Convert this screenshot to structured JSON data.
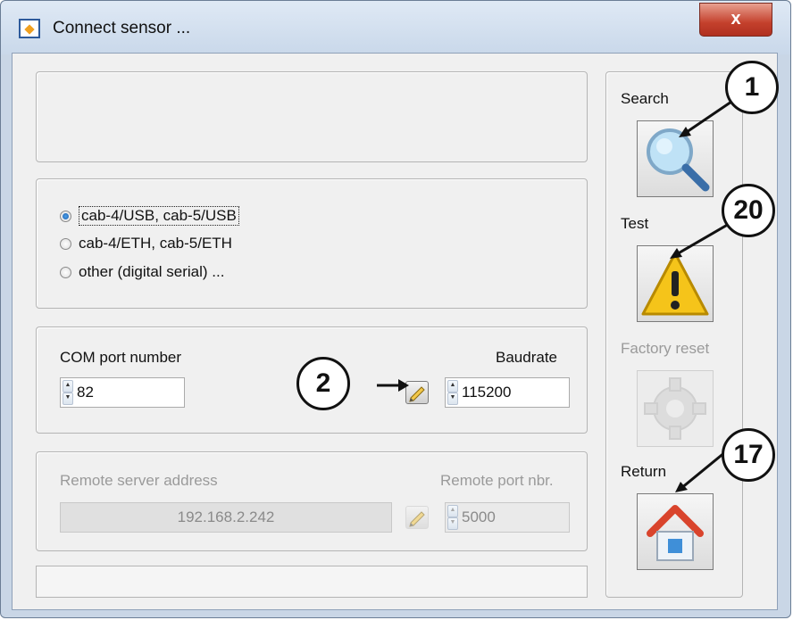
{
  "window": {
    "title": "Connect sensor ...",
    "close_label": "x"
  },
  "connection_type": {
    "options": [
      {
        "label": "cab-4/USB, cab-5/USB",
        "selected": true
      },
      {
        "label": "cab-4/ETH, cab-5/ETH",
        "selected": false
      },
      {
        "label": "other (digital serial) ...",
        "selected": false
      }
    ]
  },
  "serial": {
    "com_label": "COM port number",
    "com_value": "82",
    "baud_label": "Baudrate",
    "baud_value": "115200"
  },
  "network": {
    "address_label": "Remote server address",
    "address_value": "192.168.2.242",
    "port_label": "Remote port nbr.",
    "port_value": "5000"
  },
  "sidebar": {
    "search_label": "Search",
    "test_label": "Test",
    "factory_reset_label": "Factory reset",
    "return_label": "Return"
  },
  "callouts": {
    "search": "1",
    "test": "20",
    "edit": "2",
    "return": "17"
  },
  "icons": {
    "search": "magnifier-icon",
    "test": "warning-icon",
    "factory_reset": "gear-icon",
    "return": "home-icon",
    "edit": "pencil-icon"
  }
}
